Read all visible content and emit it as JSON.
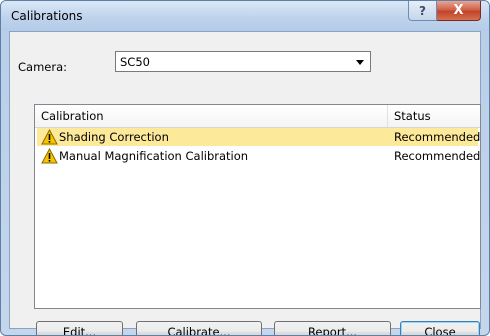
{
  "window": {
    "title": "Calibrations"
  },
  "titlebar": {
    "help_glyph": "?",
    "close_glyph": "X"
  },
  "camera": {
    "label": "Camera:",
    "value": "SC50"
  },
  "list": {
    "columns": [
      "Calibration",
      "Status"
    ],
    "rows": [
      {
        "name": "Shading Correction",
        "status": "Recommended",
        "icon": "warning-icon",
        "selected": true
      },
      {
        "name": "Manual Magnification Calibration",
        "status": "Recommended",
        "icon": "warning-icon",
        "selected": false
      }
    ]
  },
  "buttons": {
    "edit": {
      "mnemonic": "E",
      "rest": "dit..."
    },
    "calibrate": {
      "mnemonic": "C",
      "rest": "alibrate..."
    },
    "report": {
      "mnemonic": "R",
      "rest": "eport..."
    },
    "close": {
      "label": "Close"
    }
  },
  "colors": {
    "selection": "#fce99a",
    "default_button_border": "#3c7fb1"
  }
}
